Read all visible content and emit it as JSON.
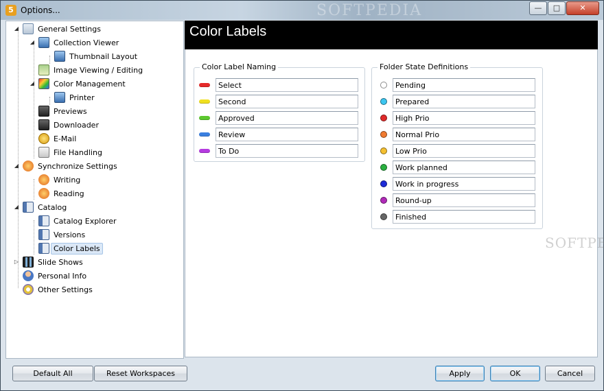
{
  "window": {
    "title": "Options...",
    "app_icon": "5",
    "watermark": "SOFTPEDIA",
    "controls": {
      "minimize": "—",
      "maximize": "□",
      "close": "✕"
    }
  },
  "tree": {
    "items": [
      {
        "label": "General Settings",
        "icon": "document-icon"
      },
      {
        "label": "Collection Viewer",
        "icon": "monitor-icon"
      },
      {
        "label": "Thumbnail Layout",
        "icon": "monitor-icon"
      },
      {
        "label": "Image Viewing / Editing",
        "icon": "picture-icon"
      },
      {
        "label": "Color Management",
        "icon": "color-icon"
      },
      {
        "label": "Printer",
        "icon": "monitor-icon"
      },
      {
        "label": "Previews",
        "icon": "camera-icon"
      },
      {
        "label": "Downloader",
        "icon": "camera-icon"
      },
      {
        "label": "E-Mail",
        "icon": "mail-icon"
      },
      {
        "label": "File Handling",
        "icon": "file-icon"
      },
      {
        "label": "Synchronize Settings",
        "icon": "sync-icon"
      },
      {
        "label": "Writing",
        "icon": "sync-icon"
      },
      {
        "label": "Reading",
        "icon": "sync-icon"
      },
      {
        "label": "Catalog",
        "icon": "catalog-icon"
      },
      {
        "label": "Catalog Explorer",
        "icon": "catalog-icon"
      },
      {
        "label": "Versions",
        "icon": "catalog-icon"
      },
      {
        "label": "Color Labels",
        "icon": "catalog-icon",
        "selected": true
      },
      {
        "label": "Slide Shows",
        "icon": "film-icon"
      },
      {
        "label": "Personal Info",
        "icon": "person-icon"
      },
      {
        "label": "Other Settings",
        "icon": "gear-icon"
      }
    ]
  },
  "page": {
    "title": "Color Labels"
  },
  "color_label_naming": {
    "title": "Color Label Naming",
    "rows": [
      {
        "color": "#e52a2a",
        "value": "Select"
      },
      {
        "color": "#f0e020",
        "value": "Second"
      },
      {
        "color": "#5cc82e",
        "value": "Approved"
      },
      {
        "color": "#3a7fe0",
        "value": "Review"
      },
      {
        "color": "#b53be0",
        "value": "To Do"
      }
    ]
  },
  "folder_state_definitions": {
    "title": "Folder State Definitions",
    "rows": [
      {
        "color": "#ffffff",
        "value": "Pending"
      },
      {
        "color": "#3cc6f0",
        "value": "Prepared"
      },
      {
        "color": "#e02a2a",
        "value": "High Prio"
      },
      {
        "color": "#f07a30",
        "value": "Normal Prio"
      },
      {
        "color": "#f5c030",
        "value": "Low Prio"
      },
      {
        "color": "#2ab040",
        "value": "Work planned"
      },
      {
        "color": "#1d2bd8",
        "value": "Work in progress"
      },
      {
        "color": "#b02ab8",
        "value": "Round-up"
      },
      {
        "color": "#666666",
        "value": "Finished"
      }
    ]
  },
  "buttons": {
    "default_all": "Default All",
    "reset_workspaces": "Reset Workspaces",
    "apply": "Apply",
    "ok": "OK",
    "cancel": "Cancel"
  }
}
